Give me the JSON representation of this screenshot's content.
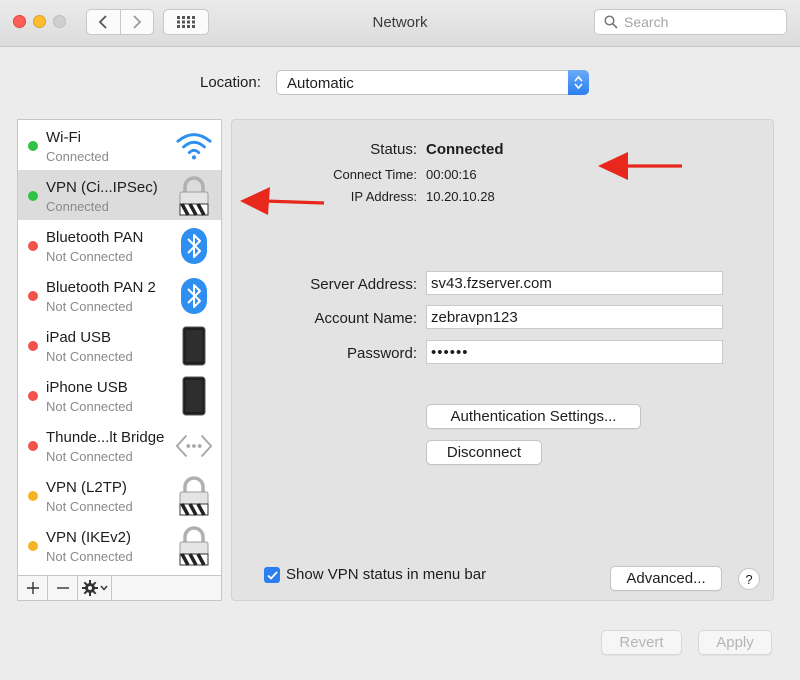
{
  "window": {
    "title": "Network"
  },
  "search": {
    "placeholder": "Search"
  },
  "location": {
    "label": "Location:",
    "value": "Automatic"
  },
  "services": [
    {
      "name": "Wi-Fi",
      "state": "Connected",
      "status_color": "#2fc244",
      "icon": "wifi-icon"
    },
    {
      "name": "VPN (Ci...IPSec)",
      "state": "Connected",
      "status_color": "#2fc244",
      "icon": "vpn-lock-icon"
    },
    {
      "name": "Bluetooth PAN",
      "state": "Not Connected",
      "status_color": "#f2524b",
      "icon": "bluetooth-icon"
    },
    {
      "name": "Bluetooth PAN 2",
      "state": "Not Connected",
      "status_color": "#f2524b",
      "icon": "bluetooth-icon"
    },
    {
      "name": "iPad USB",
      "state": "Not Connected",
      "status_color": "#f2524b",
      "icon": "ipad-icon"
    },
    {
      "name": "iPhone USB",
      "state": "Not Connected",
      "status_color": "#f2524b",
      "icon": "iphone-icon"
    },
    {
      "name": "Thunde...lt Bridge",
      "state": "Not Connected",
      "status_color": "#f2524b",
      "icon": "thunderbolt-bridge-icon"
    },
    {
      "name": "VPN (L2TP)",
      "state": "Not Connected",
      "status_color": "#f6b326",
      "icon": "vpn-lock-icon"
    },
    {
      "name": "VPN (IKEv2)",
      "state": "Not Connected",
      "status_color": "#f6b326",
      "icon": "vpn-lock-icon"
    }
  ],
  "detail": {
    "status_label": "Status:",
    "status_value": "Connected",
    "connect_time_label": "Connect Time:",
    "connect_time_value": "00:00:16",
    "ip_label": "IP Address:",
    "ip_value": "10.20.10.28",
    "server_label": "Server Address:",
    "server_value": "sv43.fzserver.com",
    "account_label": "Account Name:",
    "account_value": "zebravpn123",
    "password_label": "Password:",
    "password_value": "••••••",
    "auth_button": "Authentication Settings...",
    "disconnect_button": "Disconnect",
    "show_status_label": "Show VPN status in menu bar",
    "show_status_checked": true,
    "advanced_button": "Advanced...",
    "help_button": "?"
  },
  "footer": {
    "revert_button": "Revert",
    "apply_button": "Apply"
  },
  "colors": {
    "accent": "#2b7ff0",
    "arrow": "#e8281c"
  }
}
